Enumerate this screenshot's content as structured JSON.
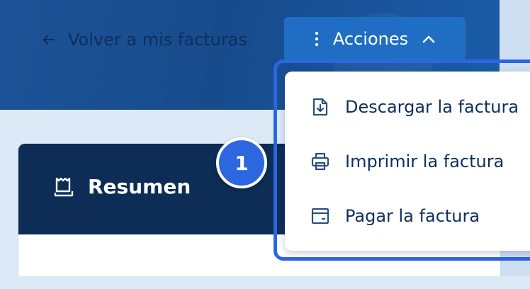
{
  "header": {
    "back_label": "Volver a mis facturas",
    "actions_label": "Acciones"
  },
  "icons": {
    "back": "arrow-left-icon",
    "actions_kebab": "vertical-dots-icon",
    "actions_chevron": "chevron-up-icon",
    "summary": "receipt-icon",
    "download": "file-download-icon",
    "print": "printer-icon",
    "pay": "credit-card-icon"
  },
  "summary_card": {
    "title": "Resumen"
  },
  "step_badge": {
    "number": "1"
  },
  "actions_menu": {
    "items": [
      {
        "label": "Descargar la factura"
      },
      {
        "label": "Imprimir la factura"
      },
      {
        "label": "Pagar la factura"
      }
    ]
  },
  "colors": {
    "primary": "#1f6ec4",
    "dark_navy": "#0d2d56",
    "highlight": "#2c67e0",
    "text": "#0f2f5c"
  }
}
